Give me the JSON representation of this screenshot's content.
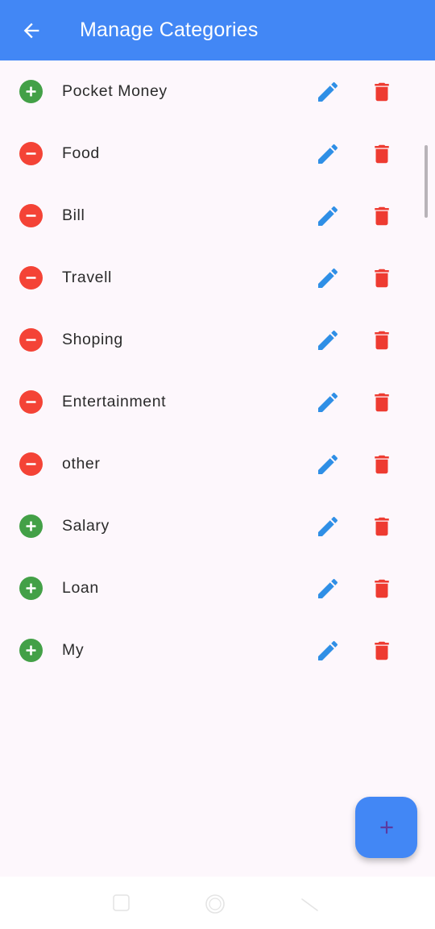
{
  "appbar": {
    "title": "Manage Categories",
    "back_icon": "arrow-back-icon",
    "background": "#4287f5"
  },
  "categories": [
    {
      "label": "Pocket Money",
      "type": "income"
    },
    {
      "label": "Food",
      "type": "expense"
    },
    {
      "label": "Bill",
      "type": "expense"
    },
    {
      "label": "Travell",
      "type": "expense"
    },
    {
      "label": "Shoping",
      "type": "expense"
    },
    {
      "label": "Entertainment",
      "type": "expense"
    },
    {
      "label": "other",
      "type": "expense"
    },
    {
      "label": "Salary",
      "type": "income"
    },
    {
      "label": "Loan",
      "type": "income"
    },
    {
      "label": "My",
      "type": "income"
    }
  ],
  "row_actions": {
    "edit_icon": "pencil-icon",
    "delete_icon": "trash-icon"
  },
  "fab": {
    "icon": "plus-icon"
  },
  "colors": {
    "income": "#43a047",
    "expense": "#f44336",
    "edit": "#2f8fe6",
    "delete": "#ee3b31",
    "fab_icon": "#5b3aa0"
  },
  "system_nav": {
    "recent_icon": "square-icon",
    "home_icon": "circle-icon",
    "back_icon": "triangle-back-icon"
  }
}
